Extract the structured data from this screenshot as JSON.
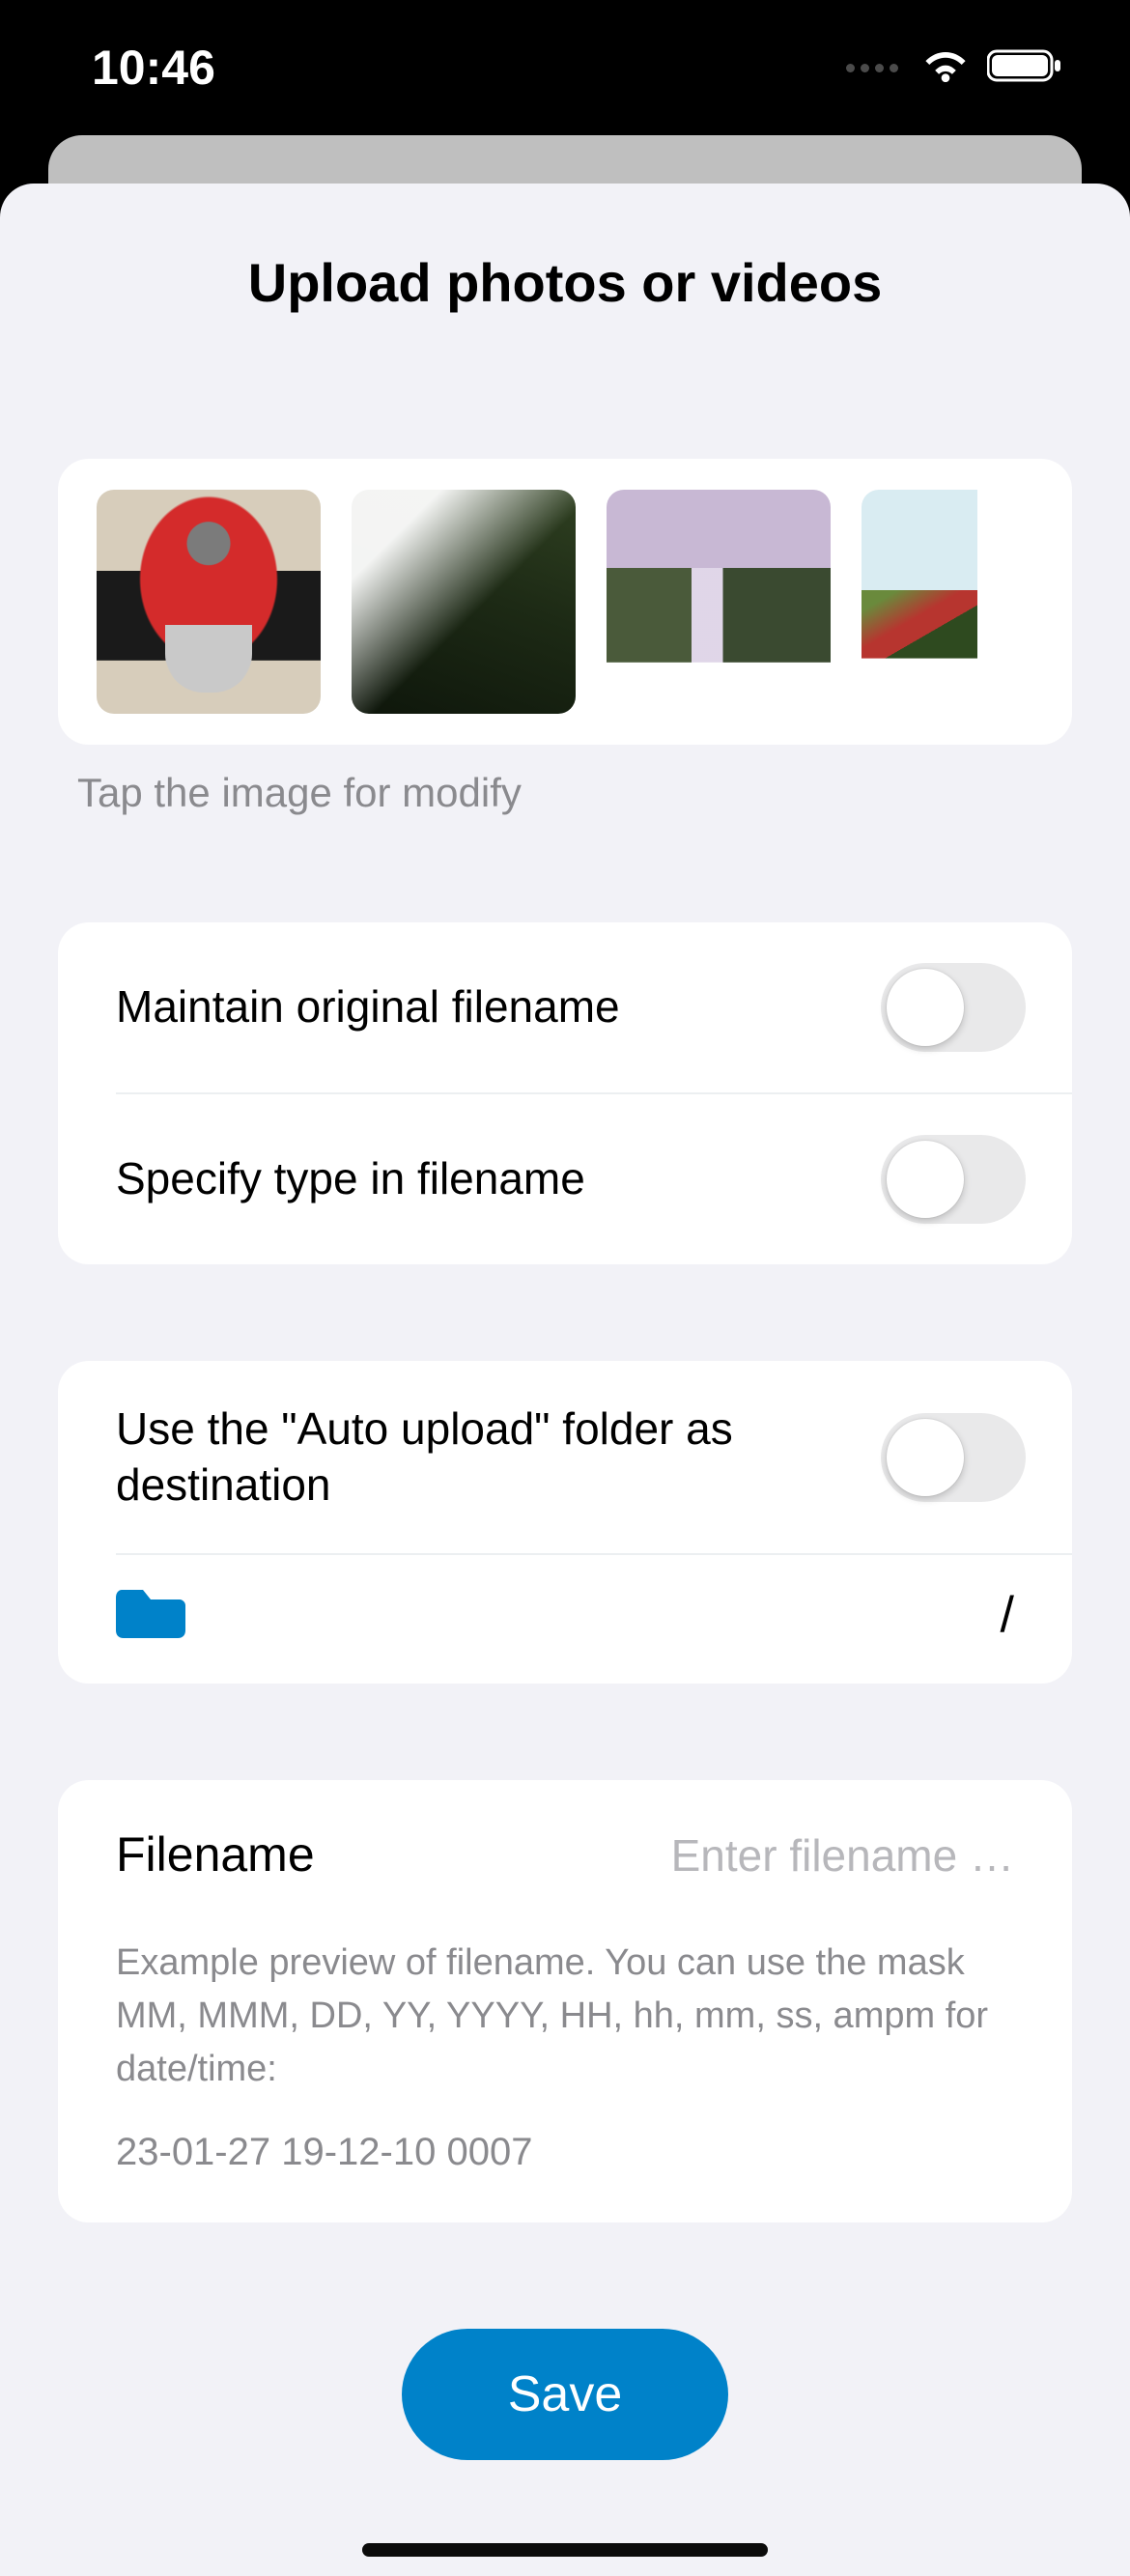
{
  "status": {
    "time": "10:46"
  },
  "sheet": {
    "title": "Upload photos or videos",
    "thumb_hint": "Tap the image for modify",
    "thumbnails": [
      {
        "name": "thumb-moka-pot"
      },
      {
        "name": "thumb-waterfall-rocks"
      },
      {
        "name": "thumb-skogafoss"
      },
      {
        "name": "thumb-coast-plants"
      }
    ],
    "toggles": {
      "maintain_original": {
        "label": "Maintain original filename",
        "on": false
      },
      "specify_type": {
        "label": "Specify type in filename",
        "on": false
      },
      "auto_upload_dest": {
        "label": "Use the \"Auto upload\" folder as destination",
        "on": false
      }
    },
    "destination_path": "/",
    "filename": {
      "label": "Filename",
      "placeholder": "Enter filename …",
      "value": "",
      "help": "Example preview of filename. You can use the mask MM, MMM, DD, YY, YYYY, HH, hh, mm, ss, ampm for date/time:",
      "example": "23-01-27 19-12-10 0007"
    },
    "save_label": "Save"
  }
}
